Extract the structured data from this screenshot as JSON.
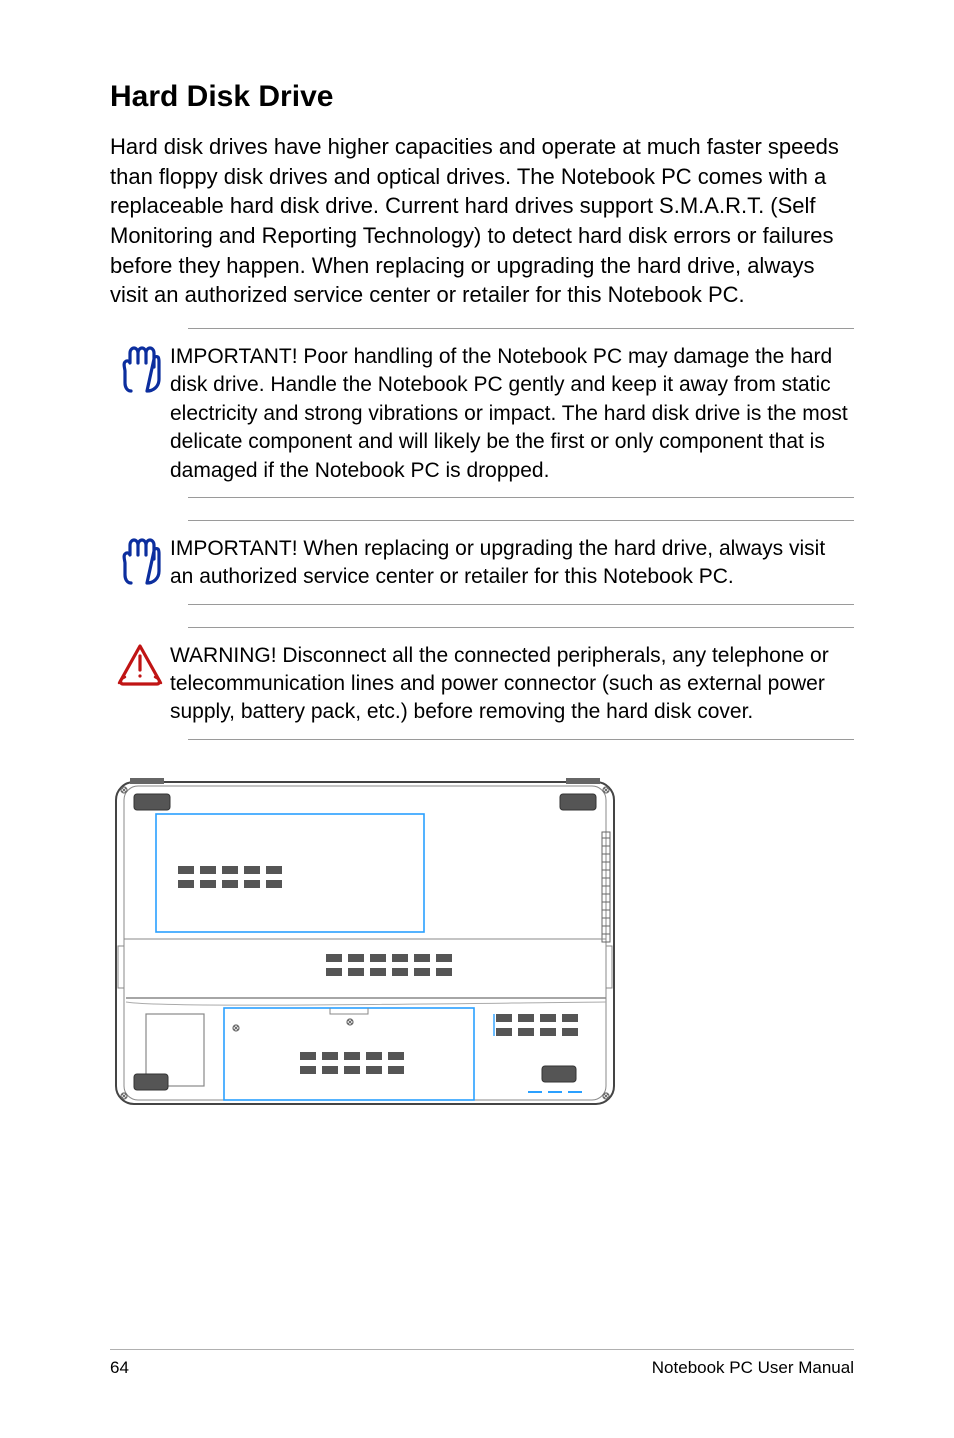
{
  "heading": "Hard Disk Drive",
  "intro": "Hard disk drives have higher capacities and operate at much faster speeds than floppy disk drives and optical drives. The Notebook PC comes with a replaceable hard disk drive. Current hard drives support S.M.A.R.T. (Self Monitoring and Reporting Technology) to detect hard disk errors or failures before they happen. When replacing or upgrading the hard drive, always visit an authorized service center or retailer for this Notebook PC.",
  "notices": [
    {
      "icon": "hand-icon",
      "text": "IMPORTANT!  Poor handling of the Notebook PC may damage the hard disk drive. Handle the Notebook PC gently and keep it away from static electricity and strong vibrations or impact. The hard disk drive is the most delicate component and will likely be the first or only component that is damaged if the Notebook PC is dropped."
    },
    {
      "icon": "hand-icon",
      "text": "IMPORTANT!  When replacing or upgrading the hard drive, always visit an authorized service center or retailer for this Notebook PC."
    },
    {
      "icon": "warning-icon",
      "text": "WARNING! Disconnect all the connected peripherals, any telephone or telecommunication lines and power connector (such as external power supply, battery pack, etc.) before removing the hard disk cover."
    }
  ],
  "footer": {
    "page": "64",
    "title": "Notebook PC User Manual"
  }
}
